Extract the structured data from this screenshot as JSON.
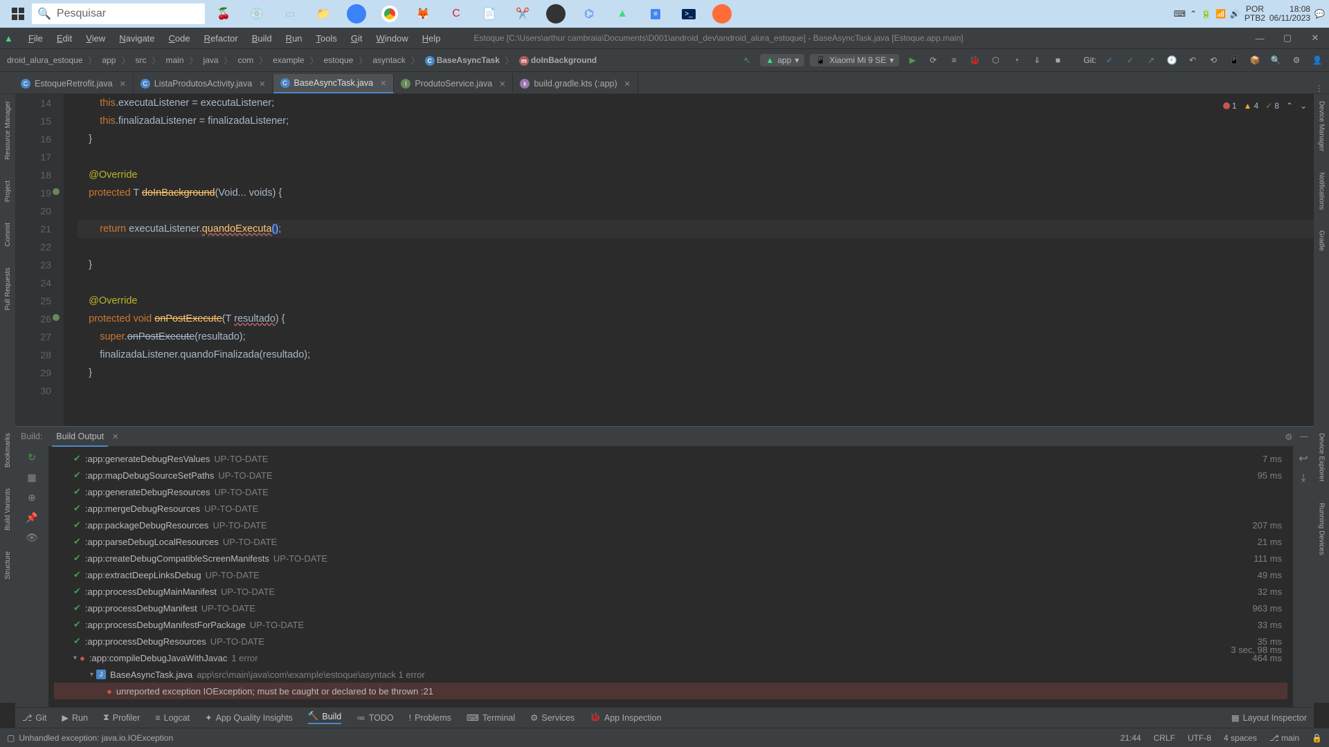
{
  "taskbar": {
    "search_placeholder": "Pesquisar",
    "lang": "POR",
    "lang2": "PTB2",
    "time": "18:08",
    "date": "06/11/2023"
  },
  "menus": [
    "File",
    "Edit",
    "View",
    "Navigate",
    "Code",
    "Refactor",
    "Build",
    "Run",
    "Tools",
    "Git",
    "Window",
    "Help"
  ],
  "window_title": "Estoque [C:\\Users\\arthur cambraia\\Documents\\D001\\android_dev\\android_alura_estoque] - BaseAsyncTask.java [Estoque.app.main]",
  "breadcrumb": [
    "droid_alura_estoque",
    "app",
    "src",
    "main",
    "java",
    "com",
    "example",
    "estoque",
    "asyntack",
    "BaseAsyncTask",
    "doInBackground"
  ],
  "run_config": "app",
  "device": "Xiaomi Mi 9 SE",
  "git_label": "Git:",
  "tabs": [
    {
      "name": "EstoqueRetrofit.java",
      "active": false,
      "color": "#4a88c7"
    },
    {
      "name": "ListaProdutosActivity.java",
      "active": false,
      "color": "#4a88c7"
    },
    {
      "name": "BaseAsyncTask.java",
      "active": true,
      "color": "#4a88c7"
    },
    {
      "name": "ProdutoService.java",
      "active": false,
      "color": "#6a8759"
    },
    {
      "name": "build.gradle.kts (:app)",
      "active": false,
      "color": "#9876aa"
    }
  ],
  "inspection": {
    "errors": "1",
    "warnings": "4",
    "weak": "8"
  },
  "code_lines": [
    {
      "n": "14",
      "html": "        <span class='kw'>this</span>.executaListener = executaListener;"
    },
    {
      "n": "15",
      "html": "        <span class='kw'>this</span>.finalizadaListener = finalizadaListener;"
    },
    {
      "n": "16",
      "html": "    }"
    },
    {
      "n": "17",
      "html": ""
    },
    {
      "n": "18",
      "html": "    <span class='ann'>@Override</span>"
    },
    {
      "n": "19",
      "html": "    <span class='kw'>protected</span> T <span class='meth strk'>doInBackground</span>(Void... voids) {",
      "marker": "override"
    },
    {
      "n": "20",
      "html": ""
    },
    {
      "n": "21",
      "html": "        <span class='kw'>return</span> executaListener.<span class='meth underl'>quandoExecuta</span><span class='caret'>()</span>;",
      "hl": true
    },
    {
      "n": "22",
      "html": ""
    },
    {
      "n": "23",
      "html": "    }"
    },
    {
      "n": "24",
      "html": ""
    },
    {
      "n": "25",
      "html": "    <span class='ann'>@Override</span>"
    },
    {
      "n": "26",
      "html": "    <span class='kw'>protected void</span> <span class='meth strk'>onPostExecute</span>(T <span class='underl'>resultado</span>) {",
      "marker": "override"
    },
    {
      "n": "27",
      "html": "        <span class='kw'>super</span>.<span class='strk'>onPostExecute</span>(resultado);"
    },
    {
      "n": "28",
      "html": "        finalizadaListener.quandoFinalizada(resultado);"
    },
    {
      "n": "29",
      "html": "    }"
    },
    {
      "n": "30",
      "html": ""
    }
  ],
  "left_tools": [
    "Resource Manager",
    "Project",
    "Commit",
    "Pull Requests"
  ],
  "left_tools2": [
    "Bookmarks",
    "Build Variants",
    "Structure"
  ],
  "right_tools": [
    "Device Manager",
    "Notifications",
    "Gradle"
  ],
  "right_tools2": [
    "Device Explorer",
    "Running Devices"
  ],
  "build": {
    "label": "Build:",
    "tab": "Build Output",
    "tasks": [
      {
        "name": ":app:generateDebugResValues",
        "status": "UP-TO-DATE",
        "time": "7 ms",
        "ok": true
      },
      {
        "name": ":app:mapDebugSourceSetPaths",
        "status": "UP-TO-DATE",
        "time": "95 ms",
        "ok": true
      },
      {
        "name": ":app:generateDebugResources",
        "status": "UP-TO-DATE",
        "time": "",
        "ok": true
      },
      {
        "name": ":app:mergeDebugResources",
        "status": "UP-TO-DATE",
        "time": "",
        "ok": true
      },
      {
        "name": ":app:packageDebugResources",
        "status": "UP-TO-DATE",
        "time": "207 ms",
        "ok": true
      },
      {
        "name": ":app:parseDebugLocalResources",
        "status": "UP-TO-DATE",
        "time": "21 ms",
        "ok": true
      },
      {
        "name": ":app:createDebugCompatibleScreenManifests",
        "status": "UP-TO-DATE",
        "time": "111 ms",
        "ok": true
      },
      {
        "name": ":app:extractDeepLinksDebug",
        "status": "UP-TO-DATE",
        "time": "49 ms",
        "ok": true
      },
      {
        "name": ":app:processDebugMainManifest",
        "status": "UP-TO-DATE",
        "time": "32 ms",
        "ok": true
      },
      {
        "name": ":app:processDebugManifest",
        "status": "UP-TO-DATE",
        "time": "963 ms",
        "ok": true
      },
      {
        "name": ":app:processDebugManifestForPackage",
        "status": "UP-TO-DATE",
        "time": "33 ms",
        "ok": true
      },
      {
        "name": ":app:processDebugResources",
        "status": "UP-TO-DATE",
        "time": "35 ms",
        "ok": true
      }
    ],
    "compile": {
      "name": ":app:compileDebugJavaWithJavac",
      "err": "1 error",
      "time": "464 ms"
    },
    "compile2_time": "3 sec, 98 ms",
    "file": {
      "name": "BaseAsyncTask.java",
      "path": "app\\src\\main\\java\\com\\example\\estoque\\asyntack",
      "err": "1 error"
    },
    "error": "unreported exception IOException; must be caught or declared to be thrown :21"
  },
  "bottom_tools": [
    {
      "label": "Git",
      "icon": "⎇"
    },
    {
      "label": "Run",
      "icon": "▶"
    },
    {
      "label": "Profiler",
      "icon": "⧗"
    },
    {
      "label": "Logcat",
      "icon": "≡"
    },
    {
      "label": "App Quality Insights",
      "icon": "✦"
    },
    {
      "label": "Build",
      "icon": "🔨",
      "active": true
    },
    {
      "label": "TODO",
      "icon": "≔"
    },
    {
      "label": "Problems",
      "icon": "!"
    },
    {
      "label": "Terminal",
      "icon": "⌨"
    },
    {
      "label": "Services",
      "icon": "⚙"
    },
    {
      "label": "App Inspection",
      "icon": "🐞"
    }
  ],
  "layout_inspector": "Layout Inspector",
  "status": {
    "left": "Unhandled exception: java.io.IOException",
    "pos": "21:44",
    "sep": "CRLF",
    "enc": "UTF-8",
    "indent": "4 spaces",
    "branch": "main"
  }
}
